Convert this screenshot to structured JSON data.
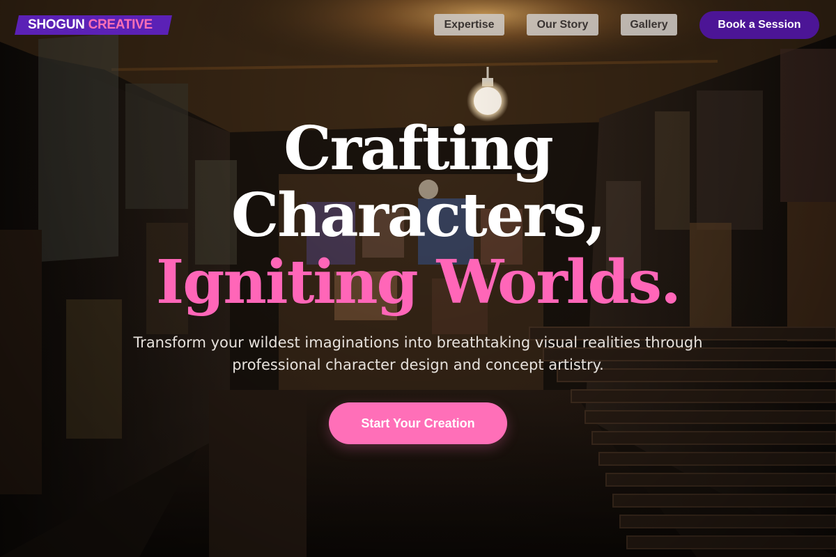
{
  "brand": {
    "part_one": "SHOGUN",
    "part_two": "CREATIVE",
    "accent_color": "#5b21b6",
    "highlight_color": "#ff6fb5"
  },
  "nav": {
    "items": [
      {
        "label": "Expertise"
      },
      {
        "label": "Our Story"
      },
      {
        "label": "Gallery"
      }
    ],
    "cta_label": "Book a Session",
    "cta_color": "#4c1596"
  },
  "hero": {
    "line_one": "Crafting",
    "line_two": "Characters,",
    "line_three": "Igniting Worlds.",
    "subtitle": "Transform your wildest imaginations into breathtaking visual realities through professional character design and concept artistry.",
    "cta_label": "Start Your Creation",
    "cta_color": "#ff6fb8"
  },
  "background": {
    "icon": "gallery-corridor-photo"
  }
}
